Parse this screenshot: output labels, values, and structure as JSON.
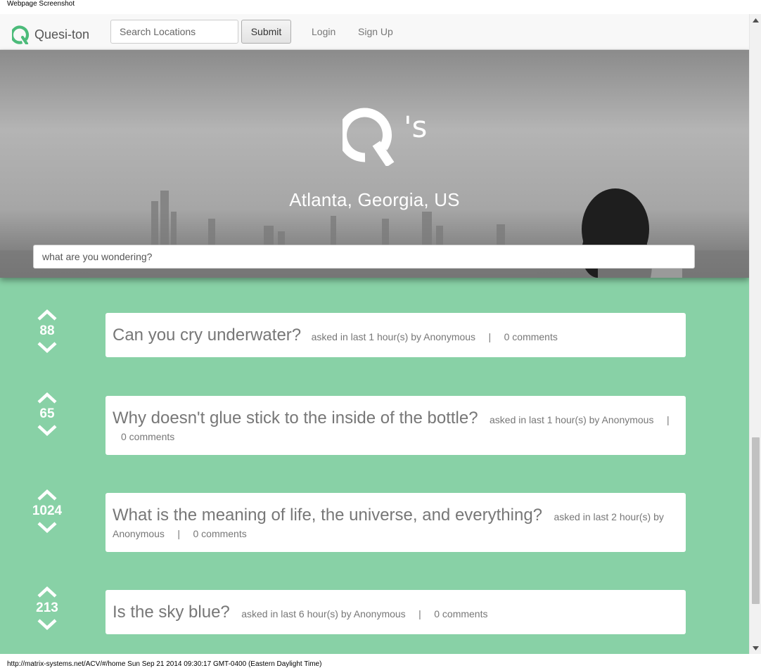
{
  "caption": {
    "top": "Webpage Screenshot",
    "bottom": "http://matrix-systems.net/ACV/#/home Sun Sep 21 2014 09:30:17 GMT-0400 (Eastern Daylight Time)"
  },
  "navbar": {
    "brand": "Quesi-ton",
    "search_placeholder": "Search Locations",
    "submit_label": "Submit",
    "links": [
      "Login",
      "Sign Up"
    ]
  },
  "hero": {
    "logo_suffix": "'s",
    "location": "Atlanta, Georgia, US",
    "ask_placeholder": "what are you wondering?"
  },
  "questions": [
    {
      "votes": "88",
      "title": "Can you cry underwater?",
      "asked": "asked in last 1 hour(s) by Anonymous",
      "separator": "|",
      "comments": "0 comments"
    },
    {
      "votes": "65",
      "title": "Why doesn't glue stick to the inside of the bottle?",
      "asked": "asked in last 1 hour(s) by Anonymous",
      "separator": "|",
      "comments": "0 comments"
    },
    {
      "votes": "1024",
      "title": "What is the meaning of life, the universe, and everything?",
      "asked": "asked in last 2 hour(s) by Anonymous",
      "separator": "|",
      "comments": "0 comments"
    },
    {
      "votes": "213",
      "title": "Is the sky blue?",
      "asked": "asked in last 6 hour(s) by Anonymous",
      "separator": "|",
      "comments": "0 comments"
    }
  ],
  "colors": {
    "accent": "#4cbb7a",
    "page_background": "#88d1a6"
  },
  "icons": {
    "brand": "q-logo-icon",
    "upvote": "chevron-up-icon",
    "downvote": "chevron-down-icon"
  }
}
